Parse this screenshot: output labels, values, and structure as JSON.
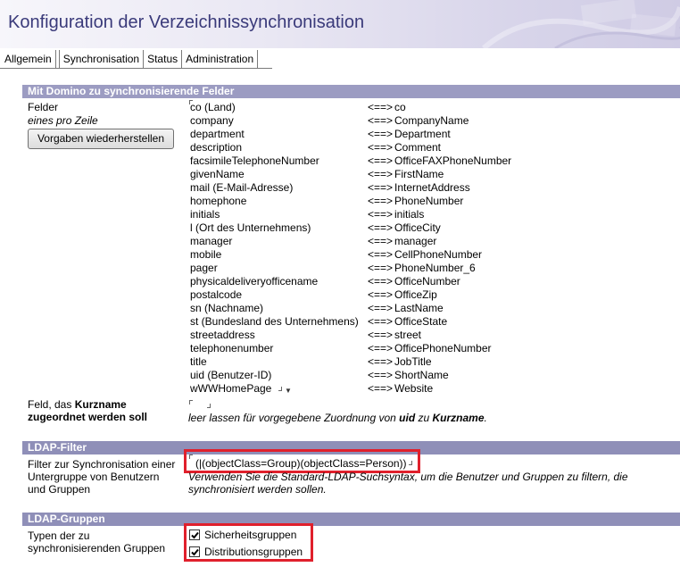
{
  "header": {
    "title": "Konfiguration der Verzeichnissynchronisation"
  },
  "tabs": [
    {
      "label": "Allgemein"
    },
    {
      "label": "Synchronisation"
    },
    {
      "label": "Status"
    },
    {
      "label": "Administration"
    }
  ],
  "section1": {
    "title": "Mit Domino zu synchronisierende Felder",
    "fields_label": "Felder",
    "fields_hint": "eines pro Zeile",
    "reset_button": "Vorgaben wiederherstellen",
    "arrow": "<==>",
    "mappings": [
      {
        "left": "co (Land)",
        "right": "co"
      },
      {
        "left": "company",
        "right": "CompanyName"
      },
      {
        "left": "department",
        "right": "Department"
      },
      {
        "left": "description",
        "right": "Comment"
      },
      {
        "left": "facsimileTelephoneNumber",
        "right": "OfficeFAXPhoneNumber"
      },
      {
        "left": "givenName",
        "right": "FirstName"
      },
      {
        "left": "mail (E-Mail-Adresse)",
        "right": "InternetAddress"
      },
      {
        "left": "homephone",
        "right": "PhoneNumber"
      },
      {
        "left": "initials",
        "right": "initials"
      },
      {
        "left": "l (Ort des Unternehmens)",
        "right": "OfficeCity"
      },
      {
        "left": "manager",
        "right": "manager"
      },
      {
        "left": "mobile",
        "right": "CellPhoneNumber"
      },
      {
        "left": "pager",
        "right": "PhoneNumber_6"
      },
      {
        "left": "physicaldeliveryofficename",
        "right": "OfficeNumber"
      },
      {
        "left": "postalcode",
        "right": "OfficeZip"
      },
      {
        "left": "sn (Nachname)",
        "right": "LastName"
      },
      {
        "left": "st (Bundesland des Unternehmens)",
        "right": "OfficeState"
      },
      {
        "left": "streetaddress",
        "right": "street"
      },
      {
        "left": "telephonenumber",
        "right": "OfficePhoneNumber"
      },
      {
        "left": "title",
        "right": "JobTitle"
      },
      {
        "left": "uid (Benutzer-ID)",
        "right": "ShortName"
      },
      {
        "left": "wWWHomePage",
        "right": "Website"
      }
    ],
    "shortname_label_a": "Feld, das ",
    "shortname_label_b": "Kurzname",
    "shortname_label_c": "zugeordnet werden soll",
    "shortname_hint_a": "leer lassen für vorgegebene Zuordnung von ",
    "shortname_hint_uid": "uid",
    "shortname_hint_zu": " zu ",
    "shortname_hint_kurzname": "Kurzname",
    "shortname_hint_end": "."
  },
  "section2": {
    "title": "LDAP-Filter",
    "label_1": "Filter zur Synchronisation einer",
    "label_2": "Untergruppe von Benutzern",
    "label_3": "und Gruppen",
    "filter_value": "(|(objectClass=Group)(objectClass=Person))",
    "hint_1": "Verwenden Sie die Standard-LDAP-Suchsyntax, um die Benutzer und Gruppen zu filtern, die",
    "hint_2": "synchronisiert werden sollen."
  },
  "section3": {
    "title": "LDAP-Gruppen",
    "label_1": "Typen der zu",
    "label_2": "synchronisierenden Gruppen",
    "options": [
      {
        "label": "Sicherheitsgruppen",
        "checked": true
      },
      {
        "label": "Distributionsgruppen",
        "checked": true
      }
    ]
  },
  "colors": {
    "section_bar": "#8f8fb8",
    "highlight": "#e0202c",
    "title": "#3a3a7a"
  }
}
